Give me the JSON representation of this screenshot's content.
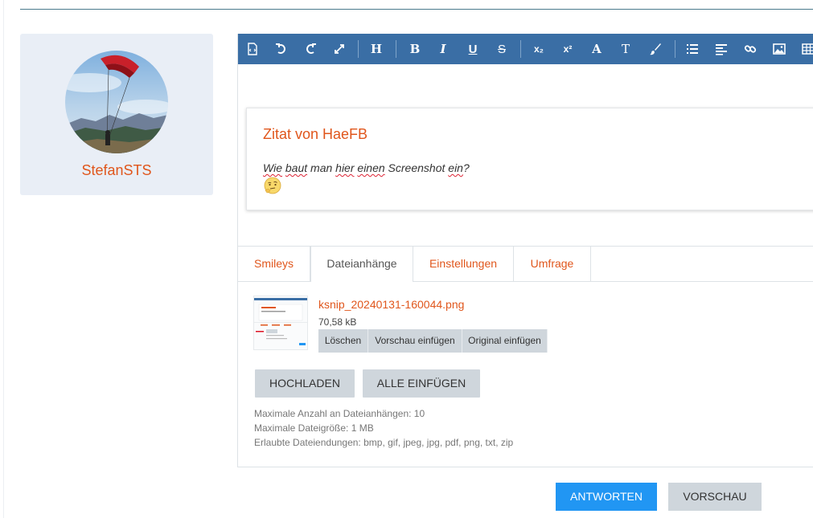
{
  "author": {
    "name": "StefanSTS",
    "avatar_icon": "paraglider-photo"
  },
  "toolbar": {
    "buttons": [
      {
        "icon": "source-icon"
      },
      {
        "icon": "undo-icon"
      },
      {
        "icon": "redo-icon"
      },
      {
        "icon": "fullscreen-icon"
      },
      {
        "icon": "heading-icon",
        "glyph": "H"
      },
      {
        "icon": "bold-icon",
        "glyph": "B"
      },
      {
        "icon": "italic-icon",
        "glyph": "I"
      },
      {
        "icon": "underline-icon",
        "glyph": "U"
      },
      {
        "icon": "strikethrough-icon",
        "glyph": "S"
      },
      {
        "icon": "subscript-icon",
        "glyph": "x₂"
      },
      {
        "icon": "superscript-icon",
        "glyph": "x²"
      },
      {
        "icon": "font-color-icon",
        "glyph": "A"
      },
      {
        "icon": "font-size-icon",
        "glyph": "T"
      },
      {
        "icon": "paint-brush-icon"
      },
      {
        "icon": "list-icon"
      },
      {
        "icon": "align-icon"
      },
      {
        "icon": "link-icon"
      },
      {
        "icon": "image-icon"
      },
      {
        "icon": "table-icon"
      }
    ],
    "background": "#3a6ea5"
  },
  "quote": {
    "title": "Zitat von HaeFB",
    "words": [
      "Wie",
      " ",
      "baut",
      " man ",
      "hier",
      " ",
      "einen",
      " Screenshot ",
      "ein",
      "?"
    ],
    "emoji": "thinking-face-icon"
  },
  "tabs": [
    {
      "label": "Smileys",
      "active": false
    },
    {
      "label": "Dateianhänge",
      "active": true
    },
    {
      "label": "Einstellungen",
      "active": false
    },
    {
      "label": "Umfrage",
      "active": false
    }
  ],
  "attachment": {
    "file_name": "ksnip_20240131-160044.png",
    "file_size": "70,58 kB",
    "actions": [
      "Löschen",
      "Vorschau einfügen",
      "Original einfügen"
    ]
  },
  "upload": {
    "upload_label": "HOCHLADEN",
    "insert_all_label": "ALLE EINFÜGEN"
  },
  "info": {
    "max_count": "Maximale Anzahl an Dateianhängen: 10",
    "max_size": "Maximale Dateigröße: 1 MB",
    "extensions": "Erlaubte Dateiendungen: bmp, gif, jpeg, jpg, pdf, png, txt, zip"
  },
  "actions": {
    "reply_label": "ANTWORTEN",
    "preview_label": "VORSCHAU"
  },
  "colors": {
    "accent": "#e0561c",
    "primary": "#2196f3",
    "button_gray": "#cfd6dc"
  }
}
